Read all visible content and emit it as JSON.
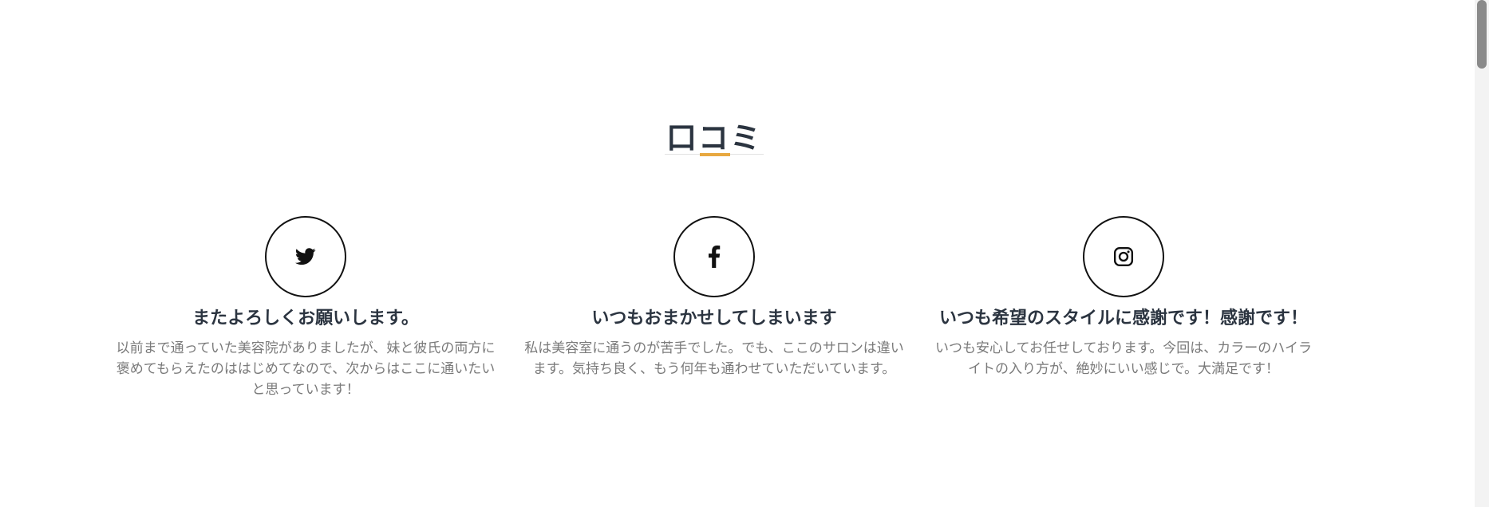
{
  "section": {
    "title": "口コミ",
    "accent_color": "#e8a840"
  },
  "reviews": [
    {
      "icon": "twitter-icon",
      "title": "またよろしくお願いします。",
      "text": "以前まで通っていた美容院がありましたが、妹と彼氏の両方に褒めてもらえたのははじめてなので、次からはここに通いたいと思っています！"
    },
    {
      "icon": "facebook-icon",
      "title": "いつもおまかせしてしまいます",
      "text": "私は美容室に通うのが苦手でした。でも、ここのサロンは違います。気持ち良く、もう何年も通わせていただいています。"
    },
    {
      "icon": "instagram-icon",
      "title": "いつも希望のスタイルに感謝です！感謝です！",
      "text": "いつも安心してお任せしております。今回は、カラーのハイライトの入り方が、絶妙にいい感じで。大満足です！"
    }
  ]
}
